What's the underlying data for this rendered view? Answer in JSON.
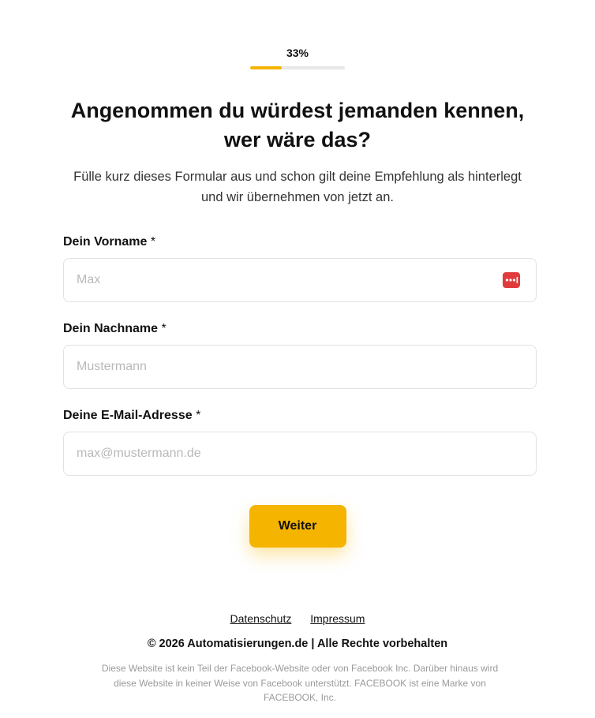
{
  "progress": {
    "label": "33%",
    "value": 0.33,
    "fill_color": "#f4b400",
    "track_color": "#e8e8e8"
  },
  "headline": "Angenommen du würdest jemanden kennen, wer wäre das?",
  "subline": "Fülle kurz dieses Formular aus und schon gilt deine Empfehlung als hinterlegt und wir übernehmen von jetzt an.",
  "form": {
    "first_name": {
      "label": "Dein Vorname",
      "required_mark": "*",
      "placeholder": "Max",
      "value": "",
      "icon": "password-manager-icon"
    },
    "last_name": {
      "label": "Dein Nachname",
      "required_mark": "*",
      "placeholder": "Mustermann",
      "value": ""
    },
    "email": {
      "label": "Deine E-Mail-Adresse",
      "required_mark": "*",
      "placeholder": "max@mustermann.de",
      "value": ""
    },
    "submit_label": "Weiter",
    "accent_color": "#f4b400"
  },
  "footer": {
    "links": {
      "privacy": "Datenschutz",
      "imprint": "Impressum"
    },
    "copyright": "© 2026 Automatisierungen.de | Alle Rechte vorbehalten",
    "disclaimer": "Diese Website ist kein Teil der Facebook-Website oder von Facebook Inc. Darüber hinaus wird diese Website in keiner Weise von Facebook unterstützt. FACEBOOK ist eine Marke von FACEBOOK, Inc."
  }
}
